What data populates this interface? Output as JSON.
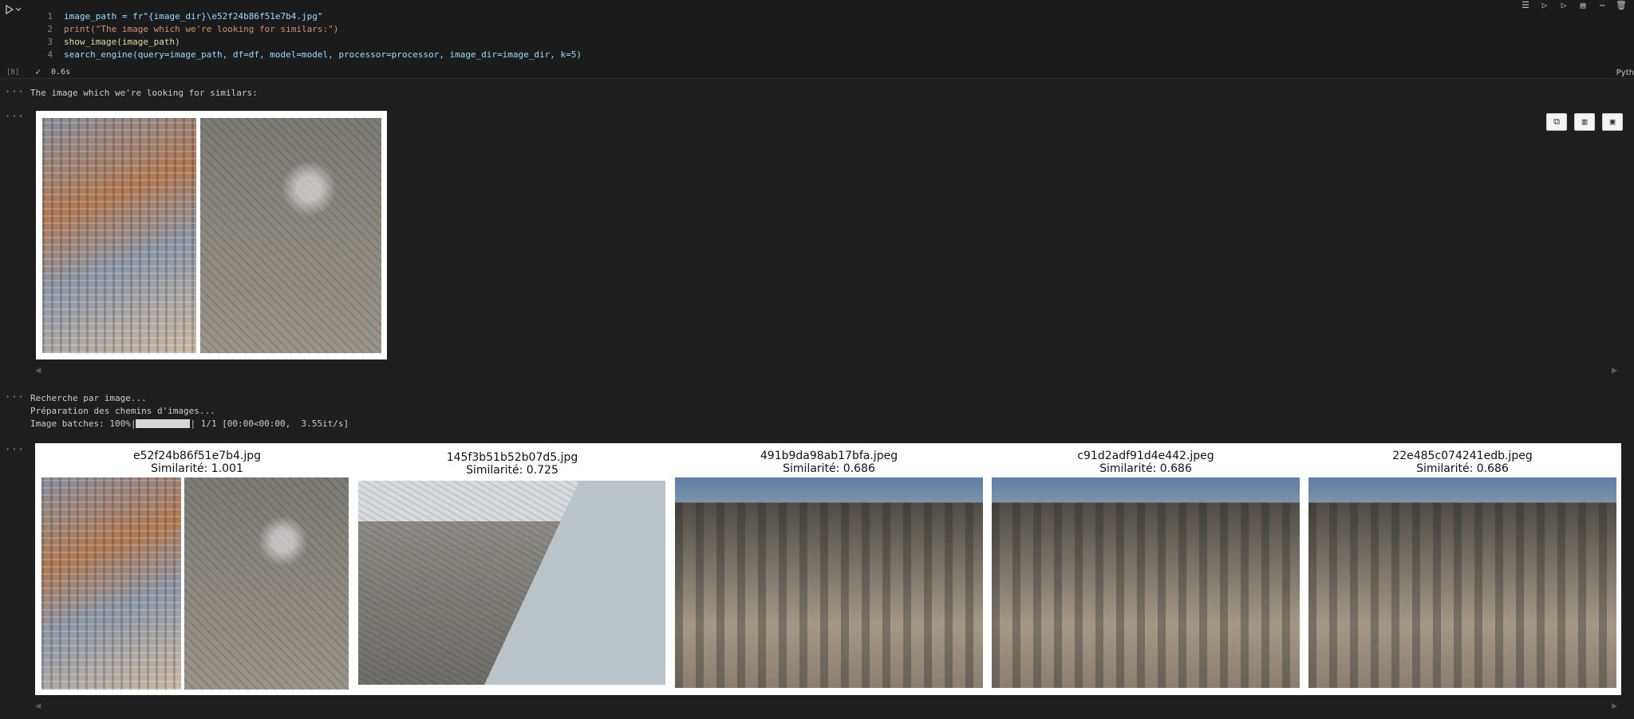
{
  "code": {
    "lines": [
      {
        "no": "1",
        "text": "image_path = fr\"{image_dir}\\e52f24b86f51e7b4.jpg\""
      },
      {
        "no": "2",
        "text": "print(\"The image which we're looking for similars:\")"
      },
      {
        "no": "3",
        "text": "show_image(image_path)"
      },
      {
        "no": "4",
        "text": "search_engine(query=image_path, df=df, model=model, processor=processor, image_dir=image_dir, k=5)"
      }
    ],
    "exec_count": "[8]",
    "exec_time": "0.6s",
    "language": "Pyth"
  },
  "outputs": {
    "dots": "···",
    "print_line": "The image which we're looking for similars:",
    "log_lines": [
      "Recherche par image...",
      "Préparation des chemins d'images..."
    ],
    "progress_prefix": "Image batches: 100%|",
    "progress_suffix": "| 1/1 [00:00<00:00,  3.55it/s]",
    "progress_value": 1.0,
    "results": [
      {
        "filename": "e52f24b86f51e7b4.jpg",
        "similarity": "Similarité: 1.001"
      },
      {
        "filename": "145f3b51b52b07d5.jpg",
        "similarity": "Similarité: 0.725"
      },
      {
        "filename": "491b9da98ab17bfa.jpeg",
        "similarity": "Similarité: 0.686"
      },
      {
        "filename": "c91d2adf91d4e442.jpeg",
        "similarity": "Similarité: 0.686"
      },
      {
        "filename": "22e485c074241edb.jpeg",
        "similarity": "Similarité: 0.686"
      }
    ]
  },
  "icons": {
    "run": "play-icon",
    "toolbar": [
      "run-above-icon",
      "run-cell-icon",
      "run-below-icon",
      "split-cell-icon",
      "more-icon",
      "delete-icon"
    ],
    "output": [
      "copy-icon",
      "chart-icon",
      "save-icon"
    ]
  }
}
